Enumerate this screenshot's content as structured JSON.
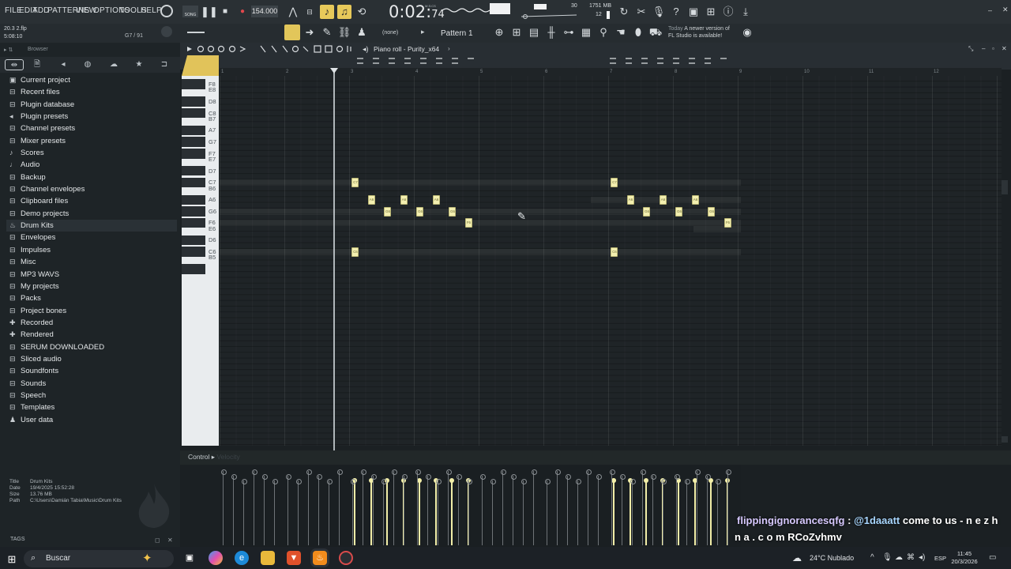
{
  "menu": [
    "FILE",
    "EDIT",
    "ADD",
    "PATTERNS",
    "VIEW",
    "OPTIONS",
    "TOOLS",
    "HELP"
  ],
  "transport": {
    "mode": "SONG",
    "bpm": "154.000",
    "time_main": "0:02:",
    "time_sub": "74",
    "time_unit": "M:S:CS"
  },
  "stats": {
    "mem": "1751 MB",
    "cpu_a": "30",
    "cpu_b": "12"
  },
  "project": {
    "file": "20.3 2.flp",
    "time": "5:08:10",
    "position": "G7 / 91"
  },
  "toolbar2": {
    "channel": "(none)",
    "pattern": "Pattern 1",
    "update_day": "Today",
    "update_msg": "A newer version of",
    "update_msg2": "FL Studio is available!"
  },
  "browser": {
    "title": "Browser",
    "items": [
      {
        "label": "Current project",
        "icon": "project-icon"
      },
      {
        "label": "Recent files",
        "icon": "folder-icon"
      },
      {
        "label": "Plugin database",
        "icon": "plug-icon"
      },
      {
        "label": "Plugin presets",
        "icon": "speaker-icon"
      },
      {
        "label": "Channel presets",
        "icon": "folder-icon"
      },
      {
        "label": "Mixer presets",
        "icon": "folder-icon"
      },
      {
        "label": "Scores",
        "icon": "note-icon"
      },
      {
        "label": "Audio",
        "icon": "audio-icon"
      },
      {
        "label": "Backup",
        "icon": "folder-icon"
      },
      {
        "label": "Channel envelopes",
        "icon": "folder-icon"
      },
      {
        "label": "Clipboard files",
        "icon": "folder-icon"
      },
      {
        "label": "Demo projects",
        "icon": "folder-icon"
      },
      {
        "label": "Drum Kits",
        "icon": "fire-icon"
      },
      {
        "label": "Envelopes",
        "icon": "folder-icon"
      },
      {
        "label": "Impulses",
        "icon": "folder-icon"
      },
      {
        "label": "Misc",
        "icon": "folder-icon"
      },
      {
        "label": "MP3 WAVS",
        "icon": "folder-icon"
      },
      {
        "label": "My projects",
        "icon": "folder-icon"
      },
      {
        "label": "Packs",
        "icon": "folder-icon"
      },
      {
        "label": "Project bones",
        "icon": "folder-icon"
      },
      {
        "label": "Recorded",
        "icon": "plus-icon"
      },
      {
        "label": "Rendered",
        "icon": "plus-icon"
      },
      {
        "label": "SERUM DOWNLOADED",
        "icon": "folder-icon"
      },
      {
        "label": "Sliced audio",
        "icon": "folder-icon"
      },
      {
        "label": "Soundfonts",
        "icon": "folder-icon"
      },
      {
        "label": "Sounds",
        "icon": "folder-icon"
      },
      {
        "label": "Speech",
        "icon": "folder-icon"
      },
      {
        "label": "Templates",
        "icon": "folder-icon"
      },
      {
        "label": "User data",
        "icon": "user-icon"
      }
    ],
    "selected_index": 12,
    "info": {
      "title_k": "Title",
      "title_v": "Drum Kits",
      "date_k": "Date",
      "date_v": "19/4/2025 15:52:28",
      "size_k": "Size",
      "size_v": "13.76 MB",
      "path_k": "Path",
      "path_v": "C:\\Users\\Damián Tabia\\Music\\Drum Kits"
    },
    "tags": "TAGS"
  },
  "piano_roll": {
    "title": "Piano roll - Purity_x64",
    "bars": [
      "1",
      "2",
      "3",
      "4",
      "5",
      "6",
      "7",
      "8",
      "9",
      "10",
      "11",
      "12"
    ],
    "key_labels": [
      "F8",
      "E8",
      "D8",
      "C8",
      "B7",
      "A7",
      "G7",
      "F7",
      "E7",
      "D7",
      "C7",
      "B6",
      "A6",
      "G6",
      "F6",
      "E6",
      "D6",
      "C6",
      "B5"
    ],
    "notes": [
      {
        "pitch": "C7",
        "bar": 3.03
      },
      {
        "pitch": "A6",
        "bar": 3.28
      },
      {
        "pitch": "G6",
        "bar": 3.53
      },
      {
        "pitch": "A6",
        "bar": 3.78
      },
      {
        "pitch": "G6",
        "bar": 4.03
      },
      {
        "pitch": "A6",
        "bar": 4.28
      },
      {
        "pitch": "G6",
        "bar": 4.53
      },
      {
        "pitch": "F6",
        "bar": 4.78
      },
      {
        "pitch": "C6",
        "bar": 3.03
      },
      {
        "pitch": "C7",
        "bar": 7.03
      },
      {
        "pitch": "A6",
        "bar": 7.28
      },
      {
        "pitch": "G6",
        "bar": 7.53
      },
      {
        "pitch": "A6",
        "bar": 7.78
      },
      {
        "pitch": "G6",
        "bar": 8.03
      },
      {
        "pitch": "A6",
        "bar": 8.28
      },
      {
        "pitch": "G6",
        "bar": 8.53
      },
      {
        "pitch": "F6",
        "bar": 8.78
      },
      {
        "pitch": "C6",
        "bar": 7.03
      }
    ],
    "note_labels": {
      "C7": "C7",
      "A6": "A6",
      "G6": "G6",
      "F6": "F6",
      "C6": "C6"
    },
    "control_label": "Control",
    "control_value": "Velocity"
  },
  "chat": {
    "user": "flippingignorancesqfg",
    "sep": " : ",
    "mention": "@1daaatt",
    "text1": " come to us - n e z h",
    "text2": "n a . c o m RCoZvhmv"
  },
  "taskbar": {
    "search": "Buscar",
    "weather": "24°C  Nublado",
    "lang": "ESP",
    "time": "11:45",
    "date": "20/3/2026"
  }
}
